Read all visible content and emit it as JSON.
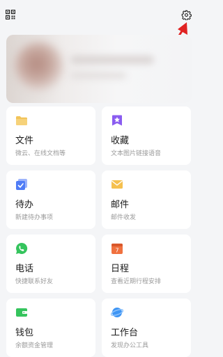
{
  "tiles": [
    {
      "title": "文件",
      "subtitle": "微云、在线文档等",
      "icon": "folder-icon",
      "color": "#f2c45a"
    },
    {
      "title": "收藏",
      "subtitle": "文本图片链接语音",
      "icon": "favorites-icon",
      "color": "#8a5cf0"
    },
    {
      "title": "待办",
      "subtitle": "新建待办事项",
      "icon": "todo-icon",
      "color": "#4f7cf6"
    },
    {
      "title": "邮件",
      "subtitle": "邮件收发",
      "icon": "mail-icon",
      "color": "#f5c04e"
    },
    {
      "title": "电话",
      "subtitle": "快捷联系好友",
      "icon": "phone-icon",
      "color": "#35c45d"
    },
    {
      "title": "日程",
      "subtitle": "查看近期行程安排",
      "icon": "calendar-icon",
      "color": "#f0713f",
      "badge": "7"
    },
    {
      "title": "钱包",
      "subtitle": "余额资金管理",
      "icon": "wallet-icon",
      "color": "#35c45d"
    },
    {
      "title": "工作台",
      "subtitle": "发现办公工具",
      "icon": "workbench-icon",
      "color": "#3e95f4"
    }
  ],
  "colors": {
    "background": "#f4f5f7",
    "card": "#ffffff",
    "annotation_arrow": "#e02222"
  }
}
